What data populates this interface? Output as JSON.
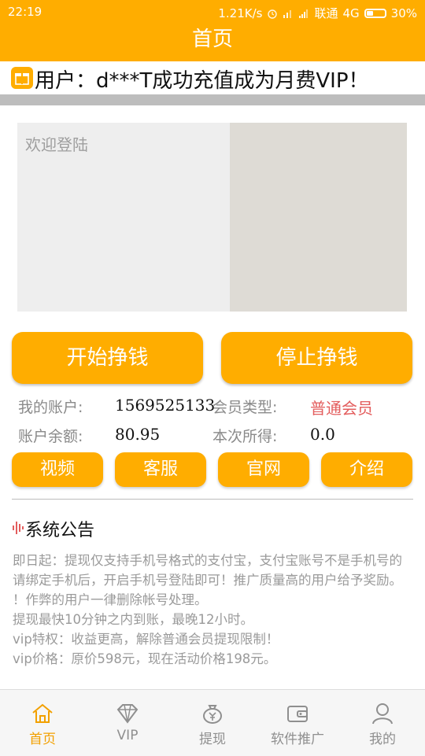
{
  "status_bar": {
    "time": "22:19",
    "speed": "1.21K/s",
    "carrier": "联通",
    "network": "4G",
    "battery": "30%"
  },
  "app_bar": {
    "title": "首页"
  },
  "marquee": {
    "text": "用户：d***T成功充值成为月费VIP！"
  },
  "banner": {
    "welcome": "欢迎登陆"
  },
  "actions": {
    "start": "开始挣钱",
    "stop": "停止挣钱"
  },
  "account": {
    "account_label": "我的账户:",
    "account_value": "1569525133",
    "member_type_label": "会员类型:",
    "member_type_value": "普通会员",
    "balance_label": "账户余额:",
    "balance_value": "80.95",
    "earned_label": "本次所得:",
    "earned_value": "0.0"
  },
  "quick_buttons": [
    "视频",
    "客服",
    "官网",
    "介绍"
  ],
  "notice": {
    "title": "系统公告",
    "lines": [
      "即日起：提现仅支持手机号格式的支付宝，支付宝账号不是手机号的请绑定手机后，开启手机号登陆即可！推广质量高的用户给予奖励。",
      "！作弊的用户一律删除帐号处理。",
      "提现最快10分钟之内到账，最晚12小时。",
      "vip特权：收益更高，解除普通会员提现限制！",
      "vip价格：原价598元，现在活动价格198元。"
    ]
  },
  "tabs": [
    {
      "label": "首页",
      "icon": "home-icon",
      "active": true
    },
    {
      "label": "VIP",
      "icon": "diamond-icon",
      "active": false
    },
    {
      "label": "提现",
      "icon": "money-bag-icon",
      "active": false
    },
    {
      "label": "软件推广",
      "icon": "wallet-icon",
      "active": false
    },
    {
      "label": "我的",
      "icon": "user-icon",
      "active": false
    }
  ],
  "colors": {
    "accent": "#ffad00",
    "member_red": "#e35d5d",
    "active_tab": "#f2a000"
  }
}
